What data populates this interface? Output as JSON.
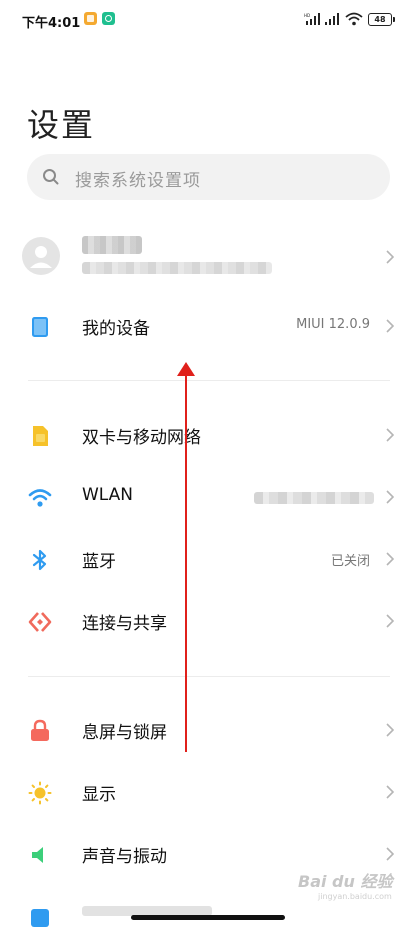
{
  "status_bar": {
    "time": "下午4:01",
    "battery": "48",
    "icons": [
      "notification-app-orange-icon",
      "notification-app-green-icon",
      "hd-signal-icon",
      "signal-icon",
      "wifi-icon",
      "battery-icon"
    ]
  },
  "title": "设置",
  "search": {
    "placeholder": "搜索系统设置项"
  },
  "account": {
    "icon": "avatar-icon"
  },
  "sections": {
    "my_device": {
      "label": "我的设备",
      "value": "MIUI 12.0.9",
      "icon": "phone-device-icon"
    },
    "sim": {
      "label": "双卡与移动网络",
      "icon": "sim-card-icon"
    },
    "wlan": {
      "label": "WLAN",
      "icon": "wifi-icon"
    },
    "bluetooth": {
      "label": "蓝牙",
      "value": "已关闭",
      "icon": "bluetooth-icon"
    },
    "share": {
      "label": "连接与共享",
      "icon": "share-connect-icon"
    },
    "lock": {
      "label": "息屏与锁屏",
      "icon": "lock-icon"
    },
    "display": {
      "label": "显示",
      "icon": "sun-icon"
    },
    "sound": {
      "label": "声音与振动",
      "icon": "speaker-icon"
    }
  },
  "watermark": {
    "text": "Bai du 经验",
    "sub": "jingyan.baidu.com"
  },
  "colors": {
    "accent_blue": "#2f9bf0",
    "sim_yellow": "#f6c22a",
    "lock_red": "#f46a5e",
    "share_red": "#f06a5c",
    "sound_green": "#3ccf7a",
    "arrow_red": "#e0201b"
  }
}
